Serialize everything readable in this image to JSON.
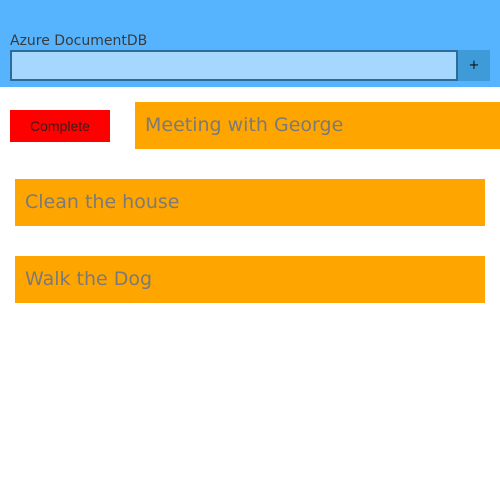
{
  "header": {
    "title": "Azure DocumentDB",
    "input_value": "",
    "add_label": "+",
    "background": "#56b4ff",
    "input_background": "#a5d7ff"
  },
  "actions": {
    "complete_label": "Complete",
    "complete_color": "#ff0000"
  },
  "todos": {
    "item_color": "#ffa500",
    "items": [
      {
        "text": "Meeting with George",
        "selected": true
      },
      {
        "text": "Clean the house",
        "selected": false
      },
      {
        "text": "Walk the Dog",
        "selected": false
      }
    ]
  }
}
